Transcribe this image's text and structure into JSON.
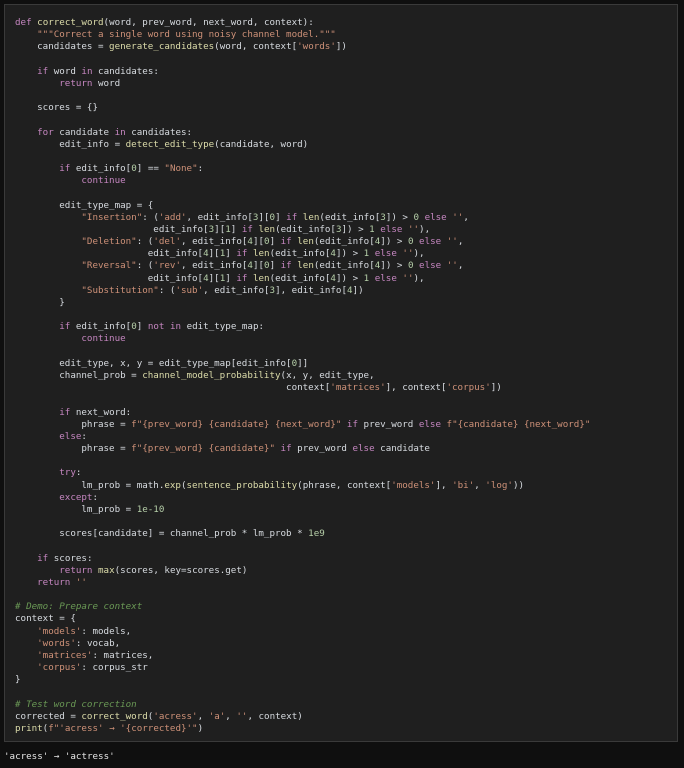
{
  "colors": {
    "background": "#0f0f0f",
    "cell_background": "#1f1f1f",
    "keyword": "#c586c0",
    "function": "#dcdcaa",
    "string": "#ce9178",
    "number": "#b5cea8",
    "comment": "#6a9955",
    "text": "#d7dbe0"
  },
  "code_lines": [
    [
      [
        "kw",
        "def"
      ],
      [
        "pl",
        " "
      ],
      [
        "fn",
        "correct_word"
      ],
      [
        "pl",
        "(word, prev_word, next_word, context):"
      ]
    ],
    [
      [
        "str",
        "    \"\"\"Correct a single word using noisy channel model.\"\"\""
      ]
    ],
    [
      [
        "pl",
        "    candidates = "
      ],
      [
        "fn",
        "generate_candidates"
      ],
      [
        "pl",
        "(word, context["
      ],
      [
        "str",
        "'words'"
      ],
      [
        "pl",
        "])"
      ]
    ],
    [],
    [
      [
        "pl",
        "    "
      ],
      [
        "kw",
        "if"
      ],
      [
        "pl",
        " word "
      ],
      [
        "kw",
        "in"
      ],
      [
        "pl",
        " candidates:"
      ]
    ],
    [
      [
        "pl",
        "        "
      ],
      [
        "kw",
        "return"
      ],
      [
        "pl",
        " word"
      ]
    ],
    [],
    [
      [
        "pl",
        "    scores = {}"
      ]
    ],
    [],
    [
      [
        "pl",
        "    "
      ],
      [
        "kw",
        "for"
      ],
      [
        "pl",
        " candidate "
      ],
      [
        "kw",
        "in"
      ],
      [
        "pl",
        " candidates:"
      ]
    ],
    [
      [
        "pl",
        "        edit_info = "
      ],
      [
        "fn",
        "detect_edit_type"
      ],
      [
        "pl",
        "(candidate, word)"
      ]
    ],
    [],
    [
      [
        "pl",
        "        "
      ],
      [
        "kw",
        "if"
      ],
      [
        "pl",
        " edit_info["
      ],
      [
        "num",
        "0"
      ],
      [
        "pl",
        "] == "
      ],
      [
        "str",
        "\"None\""
      ],
      [
        "pl",
        ":"
      ]
    ],
    [
      [
        "pl",
        "            "
      ],
      [
        "kw",
        "continue"
      ]
    ],
    [],
    [
      [
        "pl",
        "        edit_type_map = {"
      ]
    ],
    [
      [
        "pl",
        "            "
      ],
      [
        "str",
        "\"Insertion\""
      ],
      [
        "pl",
        ": ("
      ],
      [
        "str",
        "'add'"
      ],
      [
        "pl",
        ", edit_info["
      ],
      [
        "num",
        "3"
      ],
      [
        "pl",
        "]["
      ],
      [
        "num",
        "0"
      ],
      [
        "pl",
        "] "
      ],
      [
        "kw",
        "if"
      ],
      [
        "pl",
        " "
      ],
      [
        "fn",
        "len"
      ],
      [
        "pl",
        "(edit_info["
      ],
      [
        "num",
        "3"
      ],
      [
        "pl",
        "]) > "
      ],
      [
        "num",
        "0"
      ],
      [
        "pl",
        " "
      ],
      [
        "kw",
        "else"
      ],
      [
        "pl",
        " "
      ],
      [
        "str",
        "''"
      ],
      [
        "pl",
        ","
      ]
    ],
    [
      [
        "pl",
        "                         edit_info["
      ],
      [
        "num",
        "3"
      ],
      [
        "pl",
        "]["
      ],
      [
        "num",
        "1"
      ],
      [
        "pl",
        "] "
      ],
      [
        "kw",
        "if"
      ],
      [
        "pl",
        " "
      ],
      [
        "fn",
        "len"
      ],
      [
        "pl",
        "(edit_info["
      ],
      [
        "num",
        "3"
      ],
      [
        "pl",
        "]) > "
      ],
      [
        "num",
        "1"
      ],
      [
        "pl",
        " "
      ],
      [
        "kw",
        "else"
      ],
      [
        "pl",
        " "
      ],
      [
        "str",
        "''"
      ],
      [
        "pl",
        "),"
      ]
    ],
    [
      [
        "pl",
        "            "
      ],
      [
        "str",
        "\"Deletion\""
      ],
      [
        "pl",
        ": ("
      ],
      [
        "str",
        "'del'"
      ],
      [
        "pl",
        ", edit_info["
      ],
      [
        "num",
        "4"
      ],
      [
        "pl",
        "]["
      ],
      [
        "num",
        "0"
      ],
      [
        "pl",
        "] "
      ],
      [
        "kw",
        "if"
      ],
      [
        "pl",
        " "
      ],
      [
        "fn",
        "len"
      ],
      [
        "pl",
        "(edit_info["
      ],
      [
        "num",
        "4"
      ],
      [
        "pl",
        "]) > "
      ],
      [
        "num",
        "0"
      ],
      [
        "pl",
        " "
      ],
      [
        "kw",
        "else"
      ],
      [
        "pl",
        " "
      ],
      [
        "str",
        "''"
      ],
      [
        "pl",
        ","
      ]
    ],
    [
      [
        "pl",
        "                        edit_info["
      ],
      [
        "num",
        "4"
      ],
      [
        "pl",
        "]["
      ],
      [
        "num",
        "1"
      ],
      [
        "pl",
        "] "
      ],
      [
        "kw",
        "if"
      ],
      [
        "pl",
        " "
      ],
      [
        "fn",
        "len"
      ],
      [
        "pl",
        "(edit_info["
      ],
      [
        "num",
        "4"
      ],
      [
        "pl",
        "]) > "
      ],
      [
        "num",
        "1"
      ],
      [
        "pl",
        " "
      ],
      [
        "kw",
        "else"
      ],
      [
        "pl",
        " "
      ],
      [
        "str",
        "''"
      ],
      [
        "pl",
        "),"
      ]
    ],
    [
      [
        "pl",
        "            "
      ],
      [
        "str",
        "\"Reversal\""
      ],
      [
        "pl",
        ": ("
      ],
      [
        "str",
        "'rev'"
      ],
      [
        "pl",
        ", edit_info["
      ],
      [
        "num",
        "4"
      ],
      [
        "pl",
        "]["
      ],
      [
        "num",
        "0"
      ],
      [
        "pl",
        "] "
      ],
      [
        "kw",
        "if"
      ],
      [
        "pl",
        " "
      ],
      [
        "fn",
        "len"
      ],
      [
        "pl",
        "(edit_info["
      ],
      [
        "num",
        "4"
      ],
      [
        "pl",
        "]) > "
      ],
      [
        "num",
        "0"
      ],
      [
        "pl",
        " "
      ],
      [
        "kw",
        "else"
      ],
      [
        "pl",
        " "
      ],
      [
        "str",
        "''"
      ],
      [
        "pl",
        ","
      ]
    ],
    [
      [
        "pl",
        "                        edit_info["
      ],
      [
        "num",
        "4"
      ],
      [
        "pl",
        "]["
      ],
      [
        "num",
        "1"
      ],
      [
        "pl",
        "] "
      ],
      [
        "kw",
        "if"
      ],
      [
        "pl",
        " "
      ],
      [
        "fn",
        "len"
      ],
      [
        "pl",
        "(edit_info["
      ],
      [
        "num",
        "4"
      ],
      [
        "pl",
        "]) > "
      ],
      [
        "num",
        "1"
      ],
      [
        "pl",
        " "
      ],
      [
        "kw",
        "else"
      ],
      [
        "pl",
        " "
      ],
      [
        "str",
        "''"
      ],
      [
        "pl",
        "),"
      ]
    ],
    [
      [
        "pl",
        "            "
      ],
      [
        "str",
        "\"Substitution\""
      ],
      [
        "pl",
        ": ("
      ],
      [
        "str",
        "'sub'"
      ],
      [
        "pl",
        ", edit_info["
      ],
      [
        "num",
        "3"
      ],
      [
        "pl",
        "], edit_info["
      ],
      [
        "num",
        "4"
      ],
      [
        "pl",
        "])"
      ]
    ],
    [
      [
        "pl",
        "        }"
      ]
    ],
    [],
    [
      [
        "pl",
        "        "
      ],
      [
        "kw",
        "if"
      ],
      [
        "pl",
        " edit_info["
      ],
      [
        "num",
        "0"
      ],
      [
        "pl",
        "] "
      ],
      [
        "kw",
        "not in"
      ],
      [
        "pl",
        " edit_type_map:"
      ]
    ],
    [
      [
        "pl",
        "            "
      ],
      [
        "kw",
        "continue"
      ]
    ],
    [],
    [
      [
        "pl",
        "        edit_type, x, y = edit_type_map[edit_info["
      ],
      [
        "num",
        "0"
      ],
      [
        "pl",
        "]]"
      ]
    ],
    [
      [
        "pl",
        "        channel_prob = "
      ],
      [
        "fn",
        "channel_model_probability"
      ],
      [
        "pl",
        "(x, y, edit_type,"
      ]
    ],
    [
      [
        "pl",
        "                                                 context["
      ],
      [
        "str",
        "'matrices'"
      ],
      [
        "pl",
        "], context["
      ],
      [
        "str",
        "'corpus'"
      ],
      [
        "pl",
        "])"
      ]
    ],
    [],
    [
      [
        "pl",
        "        "
      ],
      [
        "kw",
        "if"
      ],
      [
        "pl",
        " next_word:"
      ]
    ],
    [
      [
        "pl",
        "            phrase = "
      ],
      [
        "str",
        "f\"{prev_word} {candidate} {next_word}\""
      ],
      [
        "pl",
        " "
      ],
      [
        "kw",
        "if"
      ],
      [
        "pl",
        " prev_word "
      ],
      [
        "kw",
        "else"
      ],
      [
        "pl",
        " "
      ],
      [
        "str",
        "f\"{candidate} {next_word}\""
      ]
    ],
    [
      [
        "pl",
        "        "
      ],
      [
        "kw",
        "else"
      ],
      [
        "pl",
        ":"
      ]
    ],
    [
      [
        "pl",
        "            phrase = "
      ],
      [
        "str",
        "f\"{prev_word} {candidate}\""
      ],
      [
        "pl",
        " "
      ],
      [
        "kw",
        "if"
      ],
      [
        "pl",
        " prev_word "
      ],
      [
        "kw",
        "else"
      ],
      [
        "pl",
        " candidate"
      ]
    ],
    [],
    [
      [
        "pl",
        "        "
      ],
      [
        "kw",
        "try"
      ],
      [
        "pl",
        ":"
      ]
    ],
    [
      [
        "pl",
        "            lm_prob = math."
      ],
      [
        "fn",
        "exp"
      ],
      [
        "pl",
        "("
      ],
      [
        "fn",
        "sentence_probability"
      ],
      [
        "pl",
        "(phrase, context["
      ],
      [
        "str",
        "'models'"
      ],
      [
        "pl",
        "], "
      ],
      [
        "str",
        "'bi'"
      ],
      [
        "pl",
        ", "
      ],
      [
        "str",
        "'log'"
      ],
      [
        "pl",
        "))"
      ]
    ],
    [
      [
        "pl",
        "        "
      ],
      [
        "kw",
        "except"
      ],
      [
        "pl",
        ":"
      ]
    ],
    [
      [
        "pl",
        "            lm_prob = "
      ],
      [
        "num",
        "1e-10"
      ]
    ],
    [],
    [
      [
        "pl",
        "        scores[candidate] = channel_prob * lm_prob * "
      ],
      [
        "num",
        "1e9"
      ]
    ],
    [],
    [
      [
        "pl",
        "    "
      ],
      [
        "kw",
        "if"
      ],
      [
        "pl",
        " scores:"
      ]
    ],
    [
      [
        "pl",
        "        "
      ],
      [
        "kw",
        "return"
      ],
      [
        "pl",
        " "
      ],
      [
        "fn",
        "max"
      ],
      [
        "pl",
        "(scores, key=scores.get)"
      ]
    ],
    [
      [
        "pl",
        "    "
      ],
      [
        "kw",
        "return"
      ],
      [
        "pl",
        " "
      ],
      [
        "str",
        "''"
      ]
    ],
    [],
    [
      [
        "com",
        "# Demo: Prepare context"
      ]
    ],
    [
      [
        "pl",
        "context = {"
      ]
    ],
    [
      [
        "pl",
        "    "
      ],
      [
        "str",
        "'models'"
      ],
      [
        "pl",
        ": models,"
      ]
    ],
    [
      [
        "pl",
        "    "
      ],
      [
        "str",
        "'words'"
      ],
      [
        "pl",
        ": vocab,"
      ]
    ],
    [
      [
        "pl",
        "    "
      ],
      [
        "str",
        "'matrices'"
      ],
      [
        "pl",
        ": matrices,"
      ]
    ],
    [
      [
        "pl",
        "    "
      ],
      [
        "str",
        "'corpus'"
      ],
      [
        "pl",
        ": corpus_str"
      ]
    ],
    [
      [
        "pl",
        "}"
      ]
    ],
    [],
    [
      [
        "com",
        "# Test word correction"
      ]
    ],
    [
      [
        "pl",
        "corrected = "
      ],
      [
        "fn",
        "correct_word"
      ],
      [
        "pl",
        "("
      ],
      [
        "str",
        "'acress'"
      ],
      [
        "pl",
        ", "
      ],
      [
        "str",
        "'a'"
      ],
      [
        "pl",
        ", "
      ],
      [
        "str",
        "''"
      ],
      [
        "pl",
        ", context)"
      ]
    ],
    [
      [
        "fn",
        "print"
      ],
      [
        "pl",
        "("
      ],
      [
        "str",
        "f\"'acress' → '{corrected}'\""
      ],
      [
        "pl",
        ")"
      ]
    ]
  ],
  "output_text": "'acress' → 'actress'"
}
